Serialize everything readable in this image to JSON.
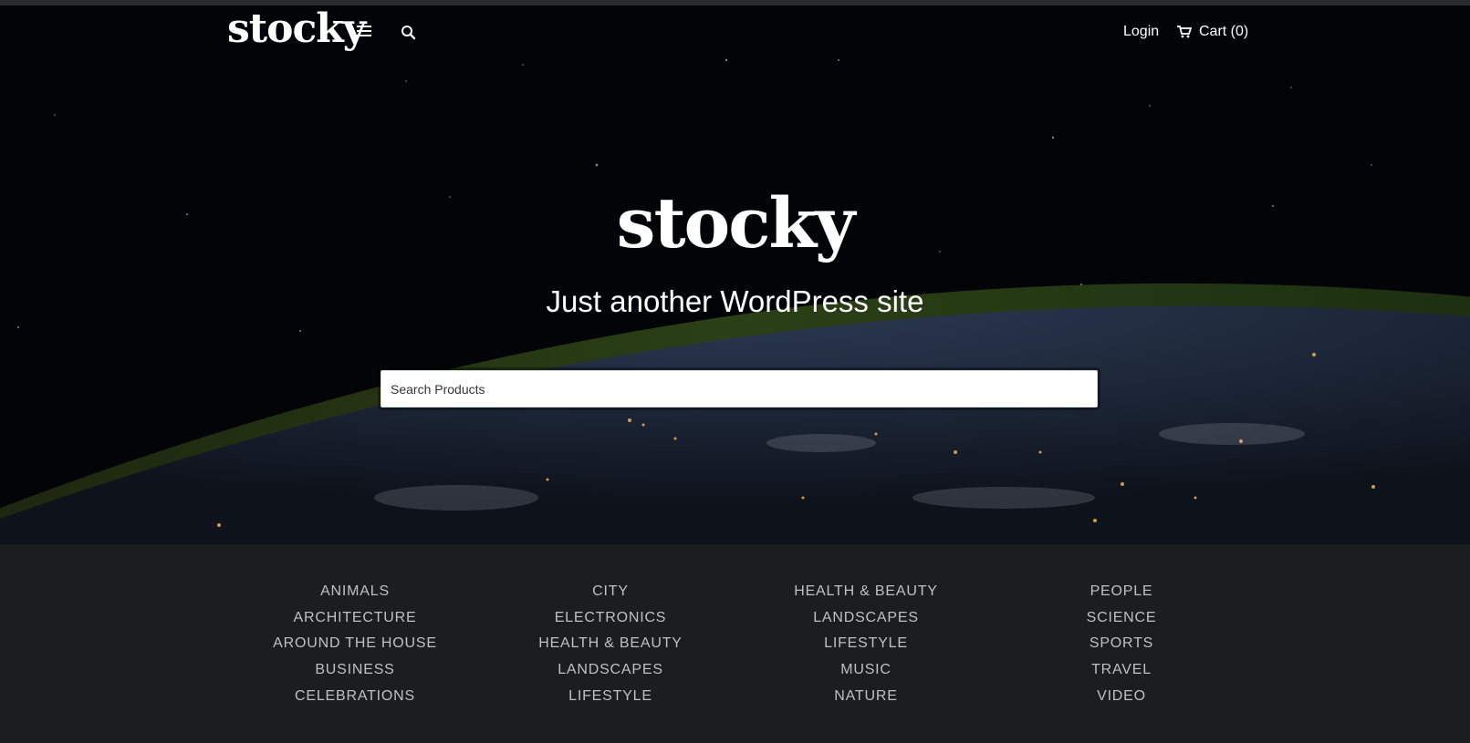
{
  "header": {
    "logo": "stocky",
    "login_label": "Login",
    "cart_label": "Cart (0)"
  },
  "hero": {
    "title": "stocky",
    "tagline": "Just another WordPress site",
    "search_placeholder": "Search Products"
  },
  "categories": {
    "columns": [
      [
        "ANIMALS",
        "ARCHITECTURE",
        "AROUND THE HOUSE",
        "BUSINESS",
        "CELEBRATIONS"
      ],
      [
        "CITY",
        "ELECTRONICS",
        "HEALTH & BEAUTY",
        "LANDSCAPES",
        "LIFESTYLE"
      ],
      [
        "HEALTH & BEAUTY",
        "LANDSCAPES",
        "LIFESTYLE",
        "MUSIC",
        "NATURE"
      ],
      [
        "PEOPLE",
        "SCIENCE",
        "SPORTS",
        "TRAVEL",
        "VIDEO"
      ]
    ]
  },
  "colors": {
    "hero_bg": "#030407",
    "footer_bg": "#1c1d1f",
    "category_text": "#bfc0c2"
  }
}
